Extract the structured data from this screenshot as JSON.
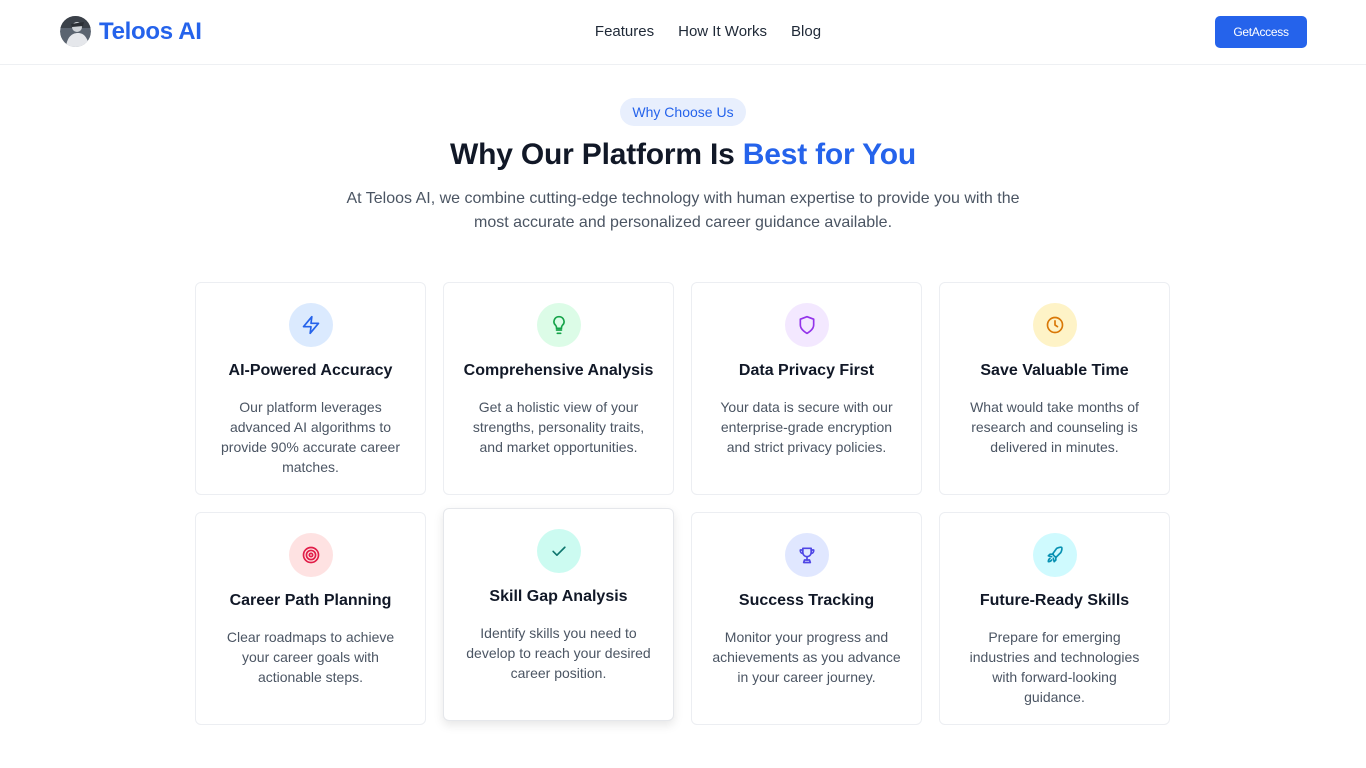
{
  "header": {
    "brand": "Teloos AI",
    "nav": [
      "Features",
      "How It Works",
      "Blog"
    ],
    "cta": "GetAccess"
  },
  "section": {
    "badge": "Why Choose Us",
    "title_main": "Why Our Platform Is ",
    "title_accent": "Best for You",
    "lead": "At Teloos AI, we combine cutting-edge technology with human expertise to provide you with the most accurate and personalized career guidance available."
  },
  "colors": {
    "brand": "#2563eb",
    "heading": "#111827",
    "body_text": "#4b5563"
  },
  "cards": [
    {
      "title": "AI-Powered Accuracy",
      "desc": "Our platform leverages advanced AI algorithms to provide 90% accurate career matches.",
      "icon": "lightning-icon",
      "bg": "#dbeafe",
      "fg": "#2563eb"
    },
    {
      "title": "Comprehensive Analysis",
      "desc": "Get a holistic view of your strengths, personality traits, and market opportunities.",
      "icon": "lightbulb-icon",
      "bg": "#dcfce7",
      "fg": "#16a34a"
    },
    {
      "title": "Data Privacy First",
      "desc": "Your data is secure with our enterprise-grade encryption and strict privacy policies.",
      "icon": "shield-icon",
      "bg": "#f3e8ff",
      "fg": "#9333ea"
    },
    {
      "title": "Save Valuable Time",
      "desc": "What would take months of research and counseling is delivered in minutes.",
      "icon": "clock-icon",
      "bg": "#fef3c7",
      "fg": "#d97706"
    },
    {
      "title": "Career Path Planning",
      "desc": "Clear roadmaps to achieve your career goals with actionable steps.",
      "icon": "target-icon",
      "bg": "#fee2e2",
      "fg": "#e11d48"
    },
    {
      "title": "Skill Gap Analysis",
      "desc": "Identify skills you need to develop to reach your desired career position.",
      "icon": "check-icon",
      "bg": "#ccfbf1",
      "fg": "#0f766e"
    },
    {
      "title": "Success Tracking",
      "desc": "Monitor your progress and achievements as you advance in your career journey.",
      "icon": "trophy-icon",
      "bg": "#e0e7ff",
      "fg": "#4f46e5"
    },
    {
      "title": "Future-Ready Skills",
      "desc": "Prepare for emerging industries and technologies with forward-looking guidance.",
      "icon": "rocket-icon",
      "bg": "#cffafe",
      "fg": "#0891b2"
    }
  ]
}
